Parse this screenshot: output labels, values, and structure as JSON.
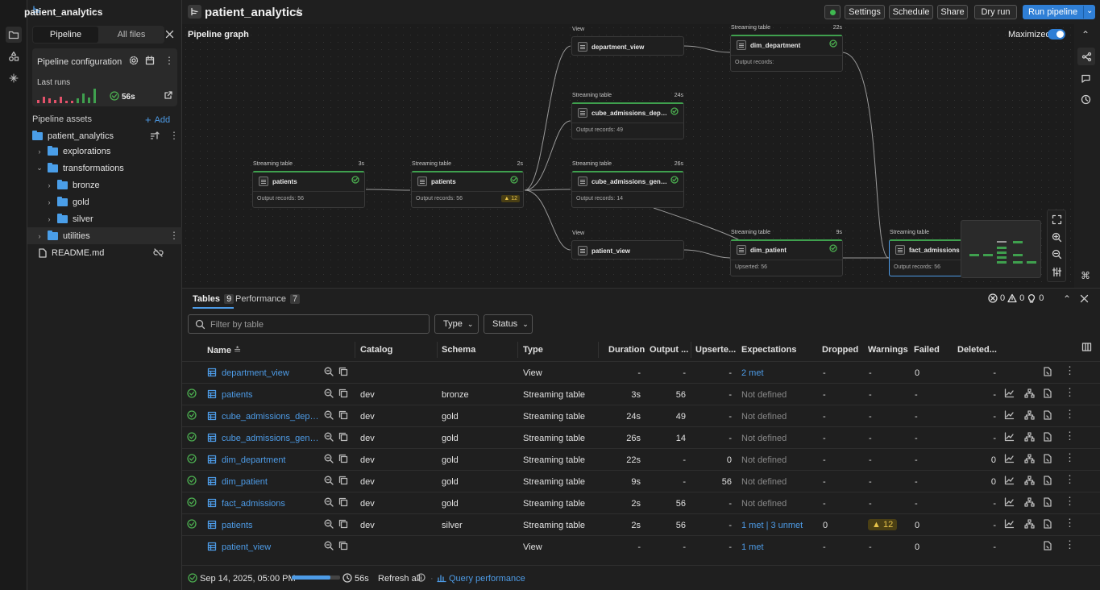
{
  "app": {
    "workspace": "patient_analytics"
  },
  "sidebar": {
    "tabs": [
      "Pipeline",
      "All files"
    ],
    "config_title": "Pipeline configuration",
    "last_runs_label": "Last runs",
    "last_run_duration": "56s",
    "assets_title": "Pipeline assets",
    "add_label": "Add",
    "tree": [
      {
        "label": "patient_analytics",
        "level": 0
      },
      {
        "label": "explorations",
        "level": 1
      },
      {
        "label": "transformations",
        "level": 1
      },
      {
        "label": "bronze",
        "level": 2
      },
      {
        "label": "gold",
        "level": 2
      },
      {
        "label": "silver",
        "level": 2
      },
      {
        "label": "utilities",
        "level": 1
      },
      {
        "label": "README.md",
        "level": 1
      }
    ]
  },
  "header": {
    "title": "patient_analytics",
    "buttons": [
      "Settings",
      "Schedule",
      "Share",
      "Dry run"
    ],
    "run_label": "Run pipeline"
  },
  "graph": {
    "title": "Pipeline graph",
    "maximized_label": "Maximized",
    "nodes": [
      {
        "id": "n1",
        "type": "Streaming table",
        "time": "3s",
        "name": "patients",
        "output": "Output records: 56"
      },
      {
        "id": "n2",
        "type": "Streaming table",
        "time": "2s",
        "name": "patients",
        "output": "Output records: 56",
        "warn": "12"
      },
      {
        "id": "n3",
        "type": "View",
        "time": "",
        "name": "department_view",
        "output": ""
      },
      {
        "id": "n4",
        "type": "Streaming table",
        "time": "24s",
        "name": "cube_admissions_departme...",
        "output": "Output records: 49"
      },
      {
        "id": "n5",
        "type": "Streaming table",
        "time": "26s",
        "name": "cube_admissions_gender_de...",
        "output": "Output records: 14"
      },
      {
        "id": "n6",
        "type": "View",
        "time": "",
        "name": "patient_view",
        "output": ""
      },
      {
        "id": "n7",
        "type": "Streaming table",
        "time": "22s",
        "name": "dim_department",
        "output": "Output records:"
      },
      {
        "id": "n8",
        "type": "Streaming table",
        "time": "9s",
        "name": "dim_patient",
        "output": "Upserted: 56"
      },
      {
        "id": "n9",
        "type": "Streaming table",
        "time": "",
        "name": "fact_admissions",
        "output": "Output records: 56"
      }
    ]
  },
  "pane": {
    "tabs": [
      {
        "label": "Tables",
        "count": "9"
      },
      {
        "label": "Performance",
        "count": "7"
      }
    ],
    "counts": {
      "errors": "0",
      "warnings": "0",
      "info": "0"
    },
    "filter_placeholder": "Filter by table",
    "type_label": "Type",
    "status_label": "Status",
    "columns": [
      "Name",
      "Catalog",
      "Schema",
      "Type",
      "Duration",
      "Output ...",
      "Upserte...",
      "Expectations",
      "Dropped",
      "Warnings",
      "Failed",
      "Deleted..."
    ],
    "rows": [
      {
        "ok": false,
        "name": "department_view",
        "catalog": "",
        "schema": "",
        "type": "View",
        "duration": "-",
        "output": "-",
        "upserted": "-",
        "expect": "2 met",
        "expect_link": true,
        "dropped": "-",
        "warnings": "-",
        "failed": "0",
        "deleted": "-",
        "charts": false
      },
      {
        "ok": true,
        "name": "patients",
        "catalog": "dev",
        "schema": "bronze",
        "type": "Streaming table",
        "duration": "3s",
        "output": "56",
        "upserted": "-",
        "expect": "Not defined",
        "expect_link": false,
        "dropped": "-",
        "warnings": "-",
        "failed": "-",
        "deleted": "-",
        "charts": true
      },
      {
        "ok": true,
        "name": "cube_admissions_departm...",
        "catalog": "dev",
        "schema": "gold",
        "type": "Streaming table",
        "duration": "24s",
        "output": "49",
        "upserted": "-",
        "expect": "Not defined",
        "expect_link": false,
        "dropped": "-",
        "warnings": "-",
        "failed": "-",
        "deleted": "-",
        "charts": true
      },
      {
        "ok": true,
        "name": "cube_admissions_gender_d...",
        "catalog": "dev",
        "schema": "gold",
        "type": "Streaming table",
        "duration": "26s",
        "output": "14",
        "upserted": "-",
        "expect": "Not defined",
        "expect_link": false,
        "dropped": "-",
        "warnings": "-",
        "failed": "-",
        "deleted": "-",
        "charts": true
      },
      {
        "ok": true,
        "name": "dim_department",
        "catalog": "dev",
        "schema": "gold",
        "type": "Streaming table",
        "duration": "22s",
        "output": "-",
        "upserted": "0",
        "expect": "Not defined",
        "expect_link": false,
        "dropped": "-",
        "warnings": "-",
        "failed": "-",
        "deleted": "0",
        "charts": true
      },
      {
        "ok": true,
        "name": "dim_patient",
        "catalog": "dev",
        "schema": "gold",
        "type": "Streaming table",
        "duration": "9s",
        "output": "-",
        "upserted": "56",
        "expect": "Not defined",
        "expect_link": false,
        "dropped": "-",
        "warnings": "-",
        "failed": "-",
        "deleted": "0",
        "charts": true
      },
      {
        "ok": true,
        "name": "fact_admissions",
        "catalog": "dev",
        "schema": "gold",
        "type": "Streaming table",
        "duration": "2s",
        "output": "56",
        "upserted": "-",
        "expect": "Not defined",
        "expect_link": false,
        "dropped": "-",
        "warnings": "-",
        "failed": "-",
        "deleted": "-",
        "charts": true
      },
      {
        "ok": true,
        "name": "patients",
        "catalog": "dev",
        "schema": "silver",
        "type": "Streaming table",
        "duration": "2s",
        "output": "56",
        "upserted": "-",
        "expect": "1 met | 3 unmet",
        "expect_link": true,
        "dropped": "0",
        "warnings": "12",
        "failed": "0",
        "deleted": "-",
        "charts": true
      },
      {
        "ok": false,
        "name": "patient_view",
        "catalog": "",
        "schema": "",
        "type": "View",
        "duration": "-",
        "output": "-",
        "upserted": "-",
        "expect": "1 met",
        "expect_link": true,
        "dropped": "-",
        "warnings": "-",
        "failed": "0",
        "deleted": "-",
        "charts": false
      }
    ],
    "footer": {
      "timestamp": "Sep 14, 2025, 05:00 PM",
      "progress": 0.8,
      "duration": "56s",
      "refresh_label": "Refresh all",
      "query_label": "Query performance"
    }
  },
  "colors": {
    "accent": "#2f7fd6",
    "ok": "#4caf50",
    "warn": "#e6b422",
    "link": "#4d9be6"
  }
}
